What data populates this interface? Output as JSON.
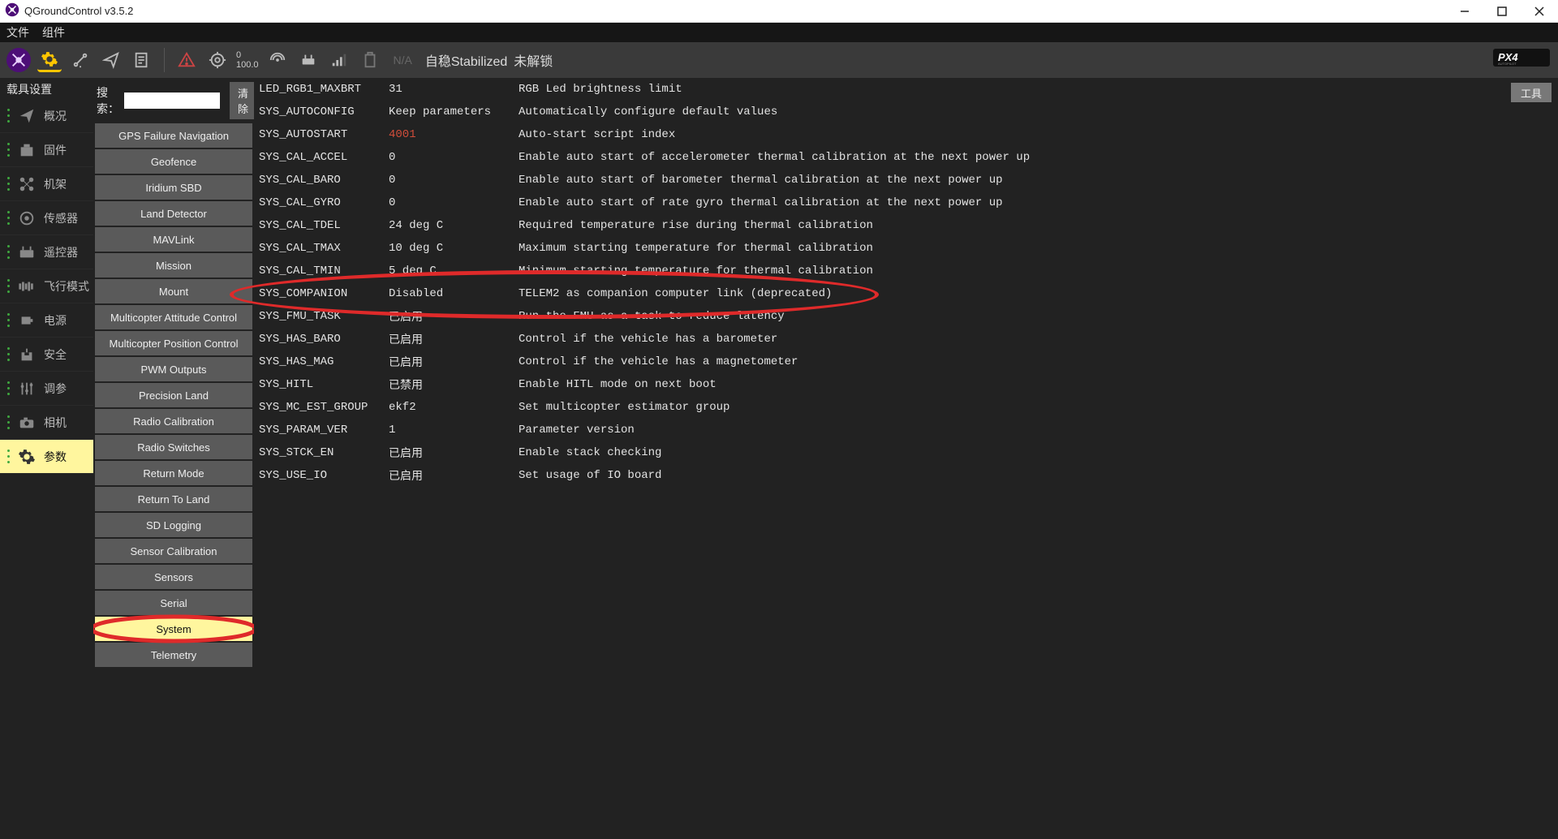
{
  "window": {
    "title": "QGroundControl v3.5.2"
  },
  "menubar": {
    "items": [
      "文件",
      "组件"
    ]
  },
  "toolbar": {
    "num_top": "0",
    "num_bottom": "100.0",
    "na": "N/A",
    "mode": "自稳Stabilized",
    "armed": "未解锁"
  },
  "sidebar": {
    "header": "载具设置",
    "items": [
      {
        "label": "概况"
      },
      {
        "label": "固件"
      },
      {
        "label": "机架"
      },
      {
        "label": "传感器"
      },
      {
        "label": "遥控器"
      },
      {
        "label": "飞行模式"
      },
      {
        "label": "电源"
      },
      {
        "label": "安全"
      },
      {
        "label": "调参"
      },
      {
        "label": "相机"
      },
      {
        "label": "参数",
        "active": true
      }
    ]
  },
  "search": {
    "label": "搜索：",
    "placeholder": "",
    "clear": "清除"
  },
  "tools_btn": "工具",
  "categories": [
    "GPS Failure Navigation",
    "Geofence",
    "Iridium SBD",
    "Land Detector",
    "MAVLink",
    "Mission",
    "Mount",
    "Multicopter Attitude Control",
    "Multicopter Position Control",
    "PWM Outputs",
    "Precision Land",
    "Radio Calibration",
    "Radio Switches",
    "Return Mode",
    "Return To Land",
    "SD Logging",
    "Sensor Calibration",
    "Sensors",
    "Serial",
    "System",
    "Telemetry"
  ],
  "selected_category": "System",
  "params": [
    {
      "name": "LED_RGB1_MAXBRT",
      "value": "31",
      "desc": "RGB Led brightness limit"
    },
    {
      "name": "SYS_AUTOCONFIG",
      "value": "Keep parameters",
      "desc": "Automatically configure default values"
    },
    {
      "name": "SYS_AUTOSTART",
      "value": "4001",
      "desc": "Auto-start script index",
      "warn": true
    },
    {
      "name": "SYS_CAL_ACCEL",
      "value": "0",
      "desc": "Enable auto start of accelerometer thermal calibration at the next power up"
    },
    {
      "name": "SYS_CAL_BARO",
      "value": "0",
      "desc": "Enable auto start of barometer thermal calibration at the next power up"
    },
    {
      "name": "SYS_CAL_GYRO",
      "value": "0",
      "desc": "Enable auto start of rate gyro thermal calibration at the next power up"
    },
    {
      "name": "SYS_CAL_TDEL",
      "value": "24 deg C",
      "desc": "Required temperature rise during thermal calibration"
    },
    {
      "name": "SYS_CAL_TMAX",
      "value": "10 deg C",
      "desc": "Maximum starting temperature for thermal calibration"
    },
    {
      "name": "SYS_CAL_TMIN",
      "value": "5 deg C",
      "desc": "Minimum starting temperature for thermal calibration"
    },
    {
      "name": "SYS_COMPANION",
      "value": "Disabled",
      "desc": "TELEM2 as companion computer link (deprecated)",
      "highlight": true
    },
    {
      "name": "SYS_FMU_TASK",
      "value": "已启用",
      "desc": "Run the FMU as a task to reduce latency"
    },
    {
      "name": "SYS_HAS_BARO",
      "value": "已启用",
      "desc": "Control if the vehicle has a barometer"
    },
    {
      "name": "SYS_HAS_MAG",
      "value": "已启用",
      "desc": "Control if the vehicle has a magnetometer"
    },
    {
      "name": "SYS_HITL",
      "value": "已禁用",
      "desc": "Enable HITL mode on next boot"
    },
    {
      "name": "SYS_MC_EST_GROUP",
      "value": "ekf2",
      "desc": "Set multicopter estimator group"
    },
    {
      "name": "SYS_PARAM_VER",
      "value": "1",
      "desc": "Parameter version"
    },
    {
      "name": "SYS_STCK_EN",
      "value": "已启用",
      "desc": "Enable stack checking"
    },
    {
      "name": "SYS_USE_IO",
      "value": "已启用",
      "desc": "Set usage of IO board"
    }
  ]
}
